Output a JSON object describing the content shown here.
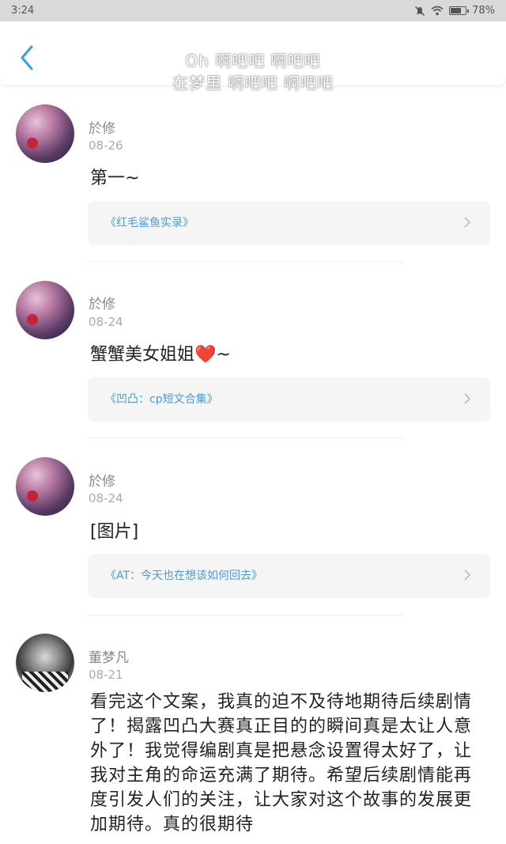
{
  "status_bar": {
    "time": "3:24",
    "battery": "78%",
    "battery_level": 0.78
  },
  "header": {
    "title_line1": "Oh 啊吧吧 啊吧吧",
    "title_line2": "在梦里 啊吧吧 啊吧吧"
  },
  "comments": [
    {
      "user": "於修",
      "date": "08-26",
      "text": "第一~",
      "card": "《红毛鲨鱼实录》"
    },
    {
      "user": "於修",
      "date": "08-24",
      "text": "蟹蟹美女姐姐❤️~",
      "card": "《凹凸：cp短文合集》"
    },
    {
      "user": "於修",
      "date": "08-24",
      "text": "[图片]",
      "card": "《AT：今天也在想该如何回去》"
    },
    {
      "user": "董梦凡",
      "date": "08-21",
      "text": "看完这个文案，我真的迫不及待地期待后续剧情了！揭露凹凸大赛真正目的的瞬间真是太让人意外了！我觉得编剧真是把悬念设置得太好了，让我对主角的命运充满了期待。希望后续剧情能再度引发人们的关注，让大家对这个故事的发展更加期待。真的很期待"
    }
  ],
  "icons": {
    "back": "back-arrow-icon",
    "chevron": "chevron-right-icon"
  },
  "colors": {
    "accent": "#3a9ee4",
    "card_text": "#4a9bd6"
  }
}
